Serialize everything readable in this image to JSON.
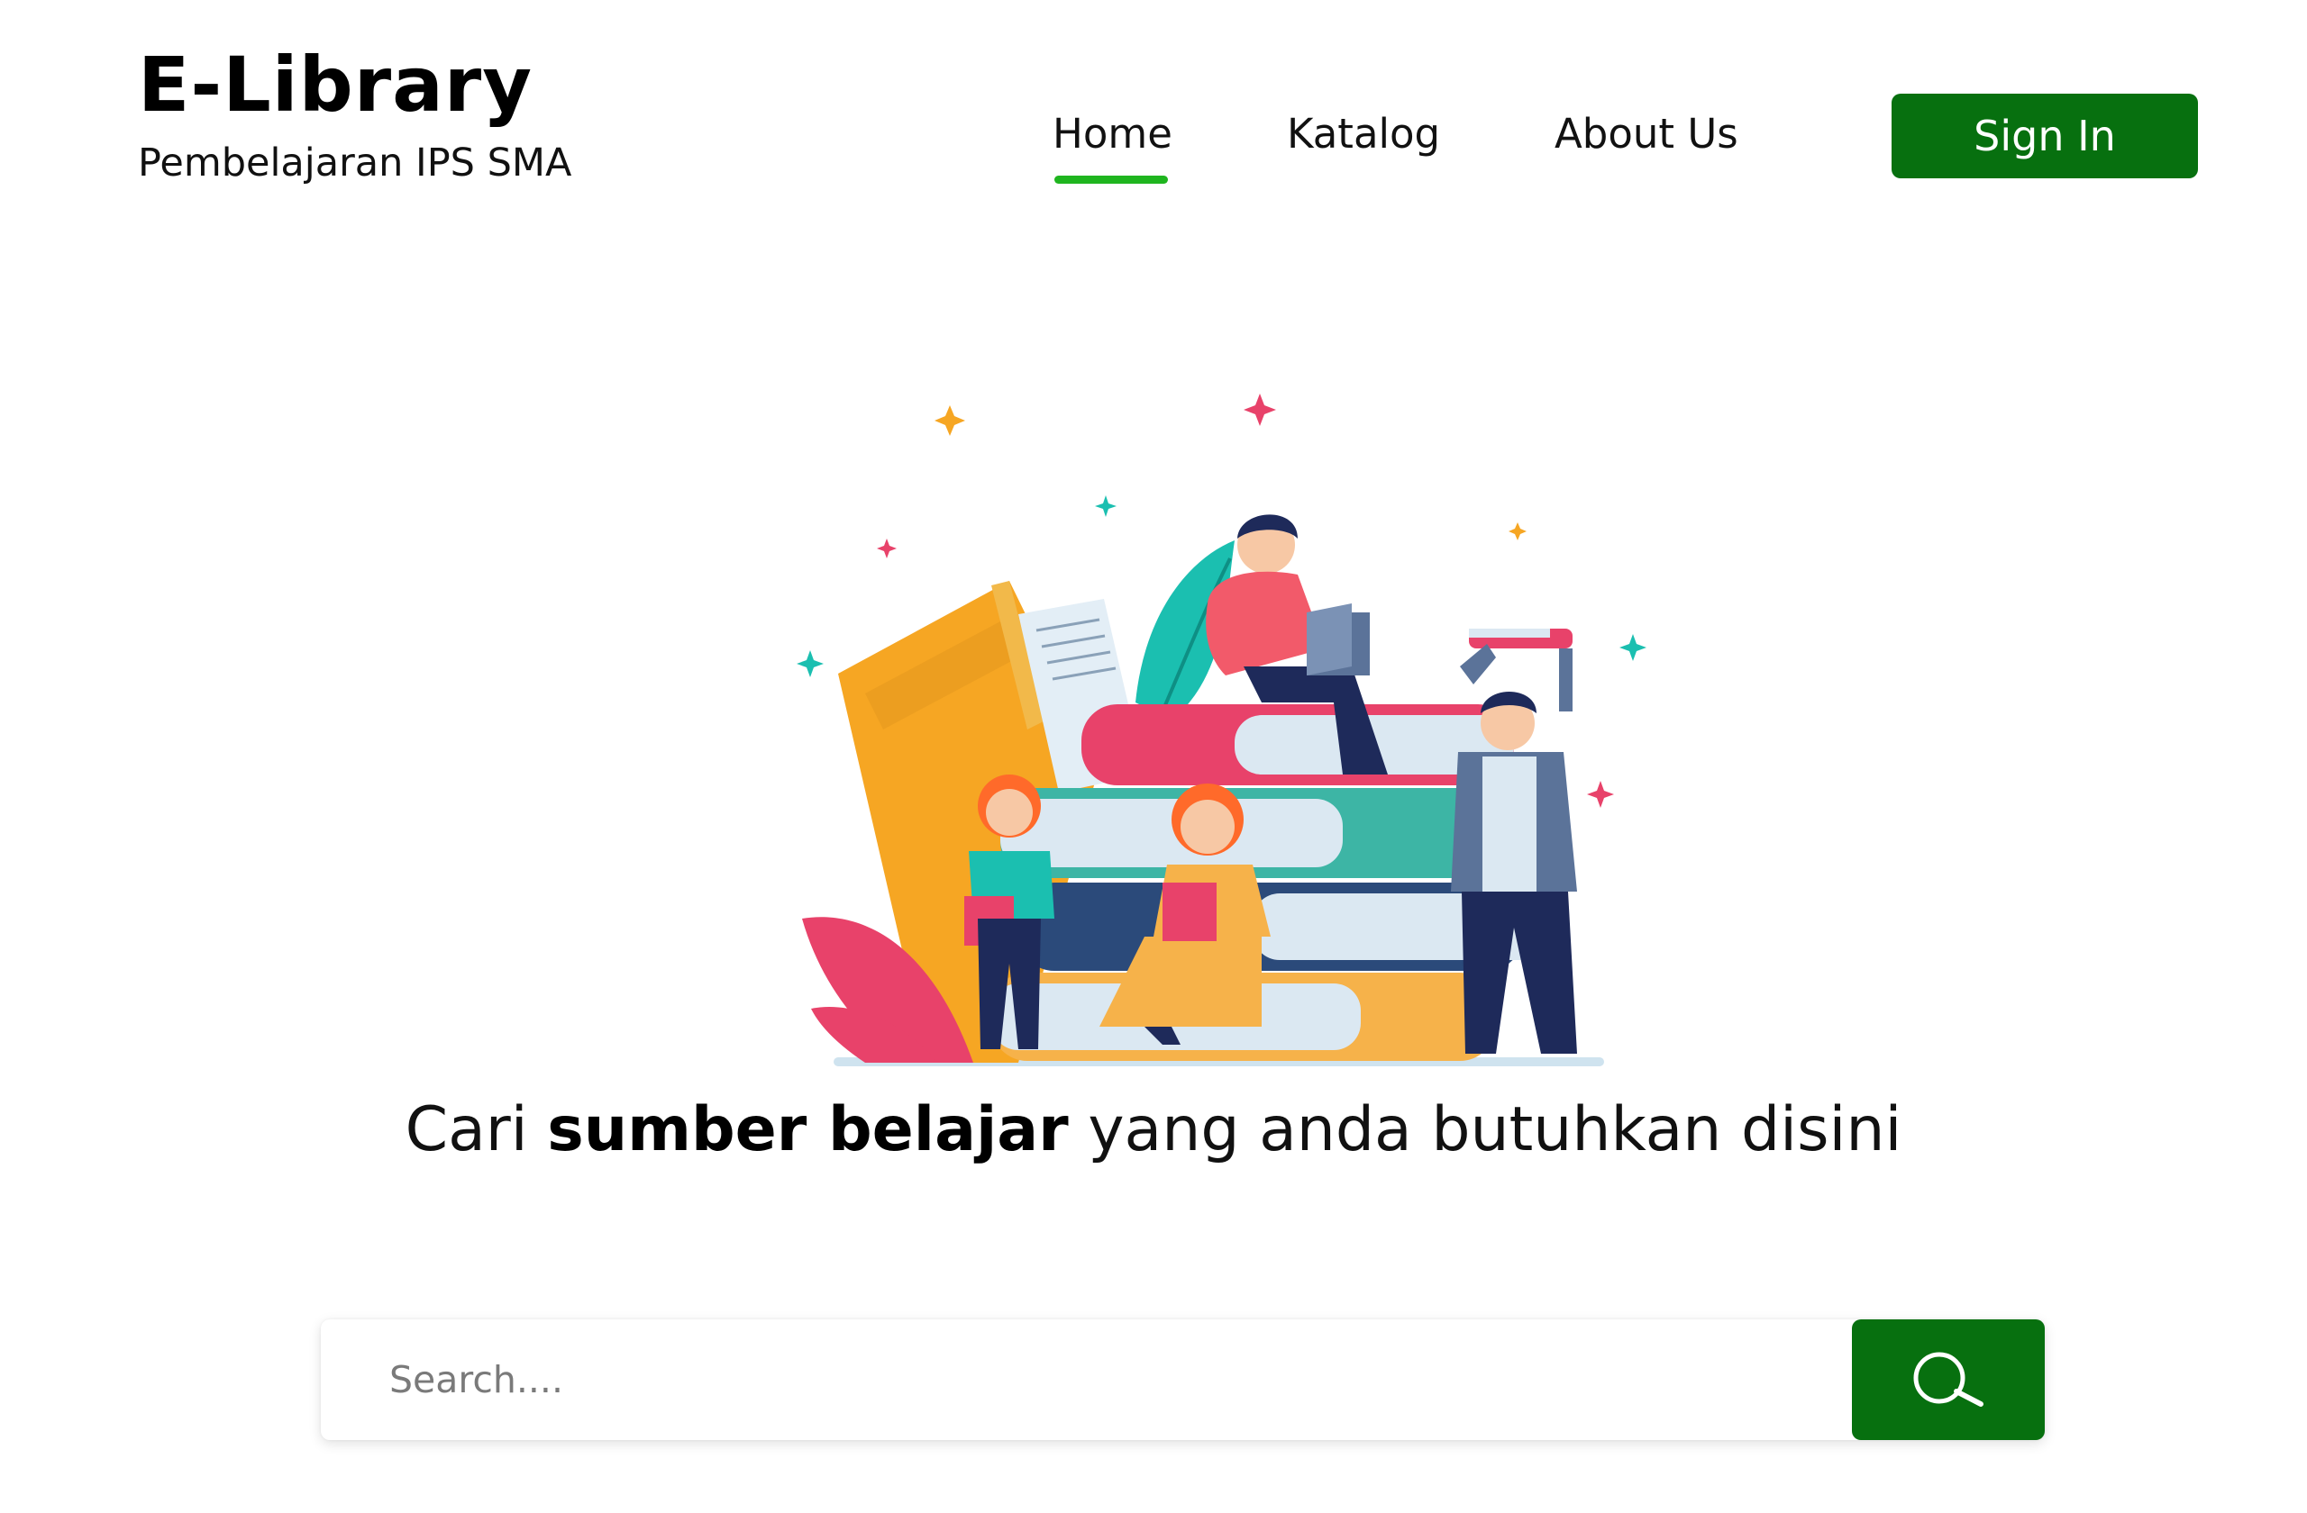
{
  "brand": {
    "title": "E-Library",
    "subtitle": "Pembelajaran IPS SMA"
  },
  "nav": {
    "items": [
      {
        "label": "Home",
        "active": true
      },
      {
        "label": "Katalog",
        "active": false
      },
      {
        "label": "About Us",
        "active": false
      }
    ],
    "signin_label": "Sign In"
  },
  "hero": {
    "tagline_prefix": "Cari ",
    "tagline_bold": "sumber belajar",
    "tagline_suffix": " yang anda butuhkan disini"
  },
  "search": {
    "placeholder": "Search....",
    "value": "",
    "icon": "search-icon"
  },
  "colors": {
    "primary": "#07700F",
    "nav_underline": "#1FB51F",
    "text": "#111111",
    "background": "#FFFFFF"
  }
}
